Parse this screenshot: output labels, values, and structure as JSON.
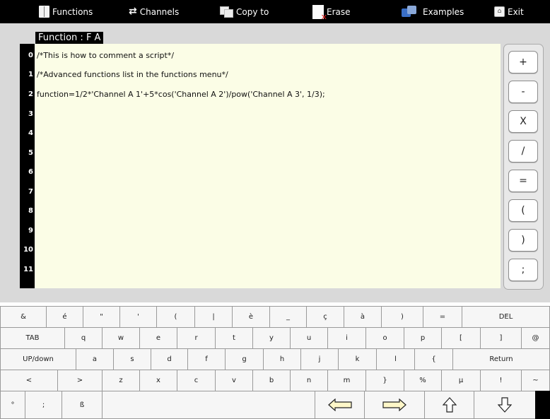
{
  "toolbar": {
    "functions": "Functions",
    "channels": "Channels",
    "copy_to": "Copy to",
    "erase": "Erase",
    "examples": "Examples",
    "exit": "Exit"
  },
  "editor": {
    "title": "Function : F A",
    "line_numbers": [
      "0",
      "1",
      "2",
      "3",
      "4",
      "5",
      "6",
      "7",
      "8",
      "9",
      "10",
      "11"
    ],
    "lines": [
      "/*This is how to comment a script*/",
      "/*Advanced functions list in the functions menu*/",
      "function=1/2*'Channel A 1'+5*cos('Channel A 2')/pow('Channel A 3', 1/3);"
    ]
  },
  "operators": [
    "+",
    "-",
    "X",
    "/",
    "=",
    "(",
    ")",
    ";"
  ],
  "keyboard": {
    "row1": [
      "&",
      "é",
      "\"",
      "'",
      "(",
      "|",
      "è",
      "_",
      "ç",
      "à",
      ")",
      "=",
      "DEL"
    ],
    "row2": [
      "TAB",
      "q",
      "w",
      "e",
      "r",
      "t",
      "y",
      "u",
      "i",
      "o",
      "p",
      "[",
      "]",
      "@"
    ],
    "row3": [
      "UP/down",
      "a",
      "s",
      "d",
      "f",
      "g",
      "h",
      "j",
      "k",
      "l",
      "{",
      "Return"
    ],
    "row4": [
      "<",
      ">",
      "z",
      "x",
      "c",
      "v",
      "b",
      "n",
      "m",
      "}",
      "%",
      "µ",
      "!",
      "~"
    ],
    "row5": [
      "°",
      ";",
      "ß"
    ]
  }
}
